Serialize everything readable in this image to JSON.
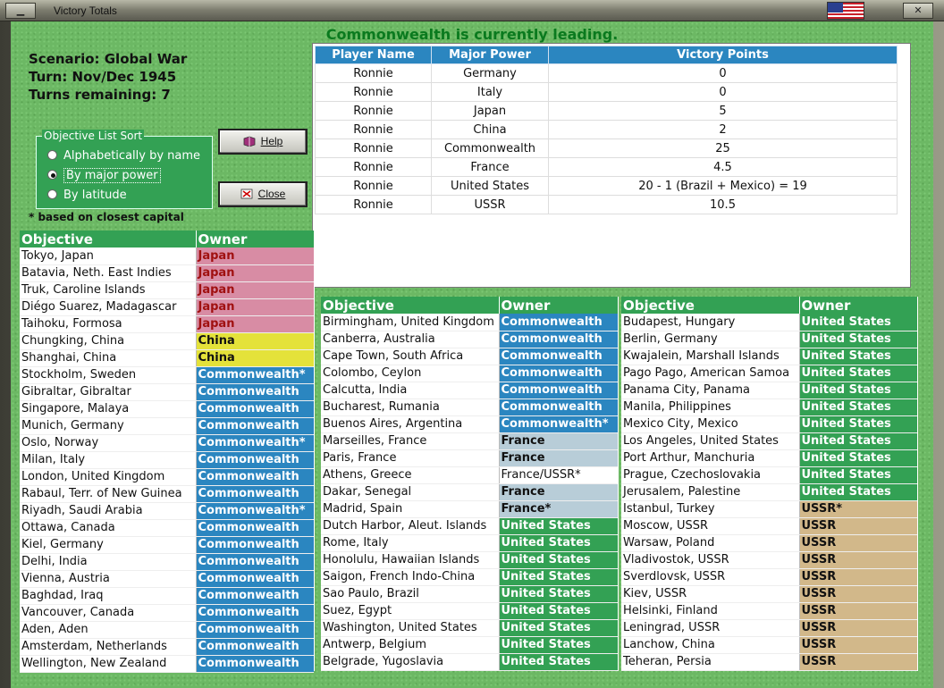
{
  "window": {
    "title": "Victory Totals",
    "minimize_label": "▁",
    "close_label": "✕"
  },
  "header": {
    "message": "Commonwealth is currently leading."
  },
  "scenario": {
    "line1": "Scenario: Global War",
    "line2": "Turn: Nov/Dec 1945",
    "line3": "Turns remaining: 7"
  },
  "sort": {
    "legend": "Objective List Sort",
    "options": [
      "Alphabetically by name",
      "By major power",
      "By latitude"
    ],
    "selected": "By major power",
    "footnote": "* based on closest capital"
  },
  "buttons": {
    "help": "Help",
    "close": "Close"
  },
  "players": {
    "headers": [
      "Player Name",
      "Major Power",
      "Victory Points"
    ],
    "rows": [
      [
        "Ronnie",
        "Germany",
        "0"
      ],
      [
        "Ronnie",
        "Italy",
        "0"
      ],
      [
        "Ronnie",
        "Japan",
        "5"
      ],
      [
        "Ronnie",
        "China",
        "2"
      ],
      [
        "Ronnie",
        "Commonwealth",
        "25"
      ],
      [
        "Ronnie",
        "France",
        "4.5"
      ],
      [
        "Ronnie",
        "United States",
        "20 - 1 (Brazil + Mexico) = 19"
      ],
      [
        "Ronnie",
        "USSR",
        "10.5"
      ]
    ]
  },
  "objectives": {
    "header_objective": "Objective",
    "header_owner": "Owner",
    "colors": {
      "japan": "#d88ca4",
      "china": "#e4e23a",
      "commonwealth": "#2b86c0",
      "france": "#b8cdd8",
      "united_states": "#33a154",
      "ussr": "#d2b88a"
    },
    "col1": [
      [
        "Tokyo, Japan",
        "Japan",
        "japan"
      ],
      [
        "Batavia, Neth. East Indies",
        "Japan",
        "japan"
      ],
      [
        "Truk, Caroline Islands",
        "Japan",
        "japan"
      ],
      [
        "Diégo Suarez, Madagascar",
        "Japan",
        "japan"
      ],
      [
        "Taihoku, Formosa",
        "Japan",
        "japan"
      ],
      [
        "Chungking, China",
        "China",
        "china"
      ],
      [
        "Shanghai, China",
        "China",
        "china"
      ],
      [
        "Stockholm, Sweden",
        "Commonwealth*",
        "cw"
      ],
      [
        "Gibraltar, Gibraltar",
        "Commonwealth",
        "cw"
      ],
      [
        "Singapore, Malaya",
        "Commonwealth",
        "cw"
      ],
      [
        "Munich, Germany",
        "Commonwealth",
        "cw"
      ],
      [
        "Oslo, Norway",
        "Commonwealth*",
        "cw"
      ],
      [
        "Milan, Italy",
        "Commonwealth",
        "cw"
      ],
      [
        "London, United Kingdom",
        "Commonwealth",
        "cw"
      ],
      [
        "Rabaul, Terr. of New Guinea",
        "Commonwealth",
        "cw"
      ],
      [
        "Riyadh, Saudi Arabia",
        "Commonwealth*",
        "cw"
      ],
      [
        "Ottawa, Canada",
        "Commonwealth",
        "cw"
      ],
      [
        "Kiel, Germany",
        "Commonwealth",
        "cw"
      ],
      [
        "Delhi, India",
        "Commonwealth",
        "cw"
      ],
      [
        "Vienna, Austria",
        "Commonwealth",
        "cw"
      ],
      [
        "Baghdad, Iraq",
        "Commonwealth",
        "cw"
      ],
      [
        "Vancouver, Canada",
        "Commonwealth",
        "cw"
      ],
      [
        "Aden, Aden",
        "Commonwealth",
        "cw"
      ],
      [
        "Amsterdam, Netherlands",
        "Commonwealth",
        "cw"
      ],
      [
        "Wellington, New Zealand",
        "Commonwealth",
        "cw"
      ]
    ],
    "col2": [
      [
        "Birmingham, United Kingdom",
        "Commonwealth",
        "cw"
      ],
      [
        "Canberra, Australia",
        "Commonwealth",
        "cw"
      ],
      [
        "Cape Town, South Africa",
        "Commonwealth",
        "cw"
      ],
      [
        "Colombo, Ceylon",
        "Commonwealth",
        "cw"
      ],
      [
        "Calcutta, India",
        "Commonwealth",
        "cw"
      ],
      [
        "Bucharest, Rumania",
        "Commonwealth",
        "cw"
      ],
      [
        "Buenos Aires, Argentina",
        "Commonwealth*",
        "cw"
      ],
      [
        "Marseilles, France",
        "France",
        "fr"
      ],
      [
        "Paris, France",
        "France",
        "fr"
      ],
      [
        "Athens, Greece",
        "France/USSR*",
        "frussr"
      ],
      [
        "Dakar, Senegal",
        "France",
        "fr"
      ],
      [
        "Madrid, Spain",
        "France*",
        "fr"
      ],
      [
        "Dutch Harbor, Aleut. Islands",
        "United States",
        "us"
      ],
      [
        "Rome, Italy",
        "United States",
        "us"
      ],
      [
        "Honolulu, Hawaiian Islands",
        "United States",
        "us"
      ],
      [
        "Saigon, French Indo-China",
        "United States",
        "us"
      ],
      [
        "Sao Paulo, Brazil",
        "United States",
        "us"
      ],
      [
        "Suez, Egypt",
        "United States",
        "us"
      ],
      [
        "Washington, United States",
        "United States",
        "us"
      ],
      [
        "Antwerp, Belgium",
        "United States",
        "us"
      ],
      [
        "Belgrade, Yugoslavia",
        "United States",
        "us"
      ]
    ],
    "col3": [
      [
        "Budapest, Hungary",
        "United States",
        "us"
      ],
      [
        "Berlin, Germany",
        "United States",
        "us"
      ],
      [
        "Kwajalein, Marshall Islands",
        "United States",
        "us"
      ],
      [
        "Pago Pago, American Samoa",
        "United States",
        "us"
      ],
      [
        "Panama City, Panama",
        "United States",
        "us"
      ],
      [
        "Manila, Philippines",
        "United States",
        "us"
      ],
      [
        "Mexico City, Mexico",
        "United States",
        "us"
      ],
      [
        "Los Angeles, United States",
        "United States",
        "us"
      ],
      [
        "Port Arthur, Manchuria",
        "United States",
        "us"
      ],
      [
        "Prague, Czechoslovakia",
        "United States",
        "us"
      ],
      [
        "Jerusalem, Palestine",
        "United States",
        "us"
      ],
      [
        "Istanbul, Turkey",
        "USSR*",
        "ussr"
      ],
      [
        "Moscow, USSR",
        "USSR",
        "ussr"
      ],
      [
        "Warsaw, Poland",
        "USSR",
        "ussr"
      ],
      [
        "Vladivostok, USSR",
        "USSR",
        "ussr"
      ],
      [
        "Sverdlovsk, USSR",
        "USSR",
        "ussr"
      ],
      [
        "Kiev, USSR",
        "USSR",
        "ussr"
      ],
      [
        "Helsinki, Finland",
        "USSR",
        "ussr"
      ],
      [
        "Leningrad, USSR",
        "USSR",
        "ussr"
      ],
      [
        "Lanchow, China",
        "USSR",
        "ussr"
      ],
      [
        "Teheran, Persia",
        "USSR",
        "ussr"
      ]
    ]
  }
}
